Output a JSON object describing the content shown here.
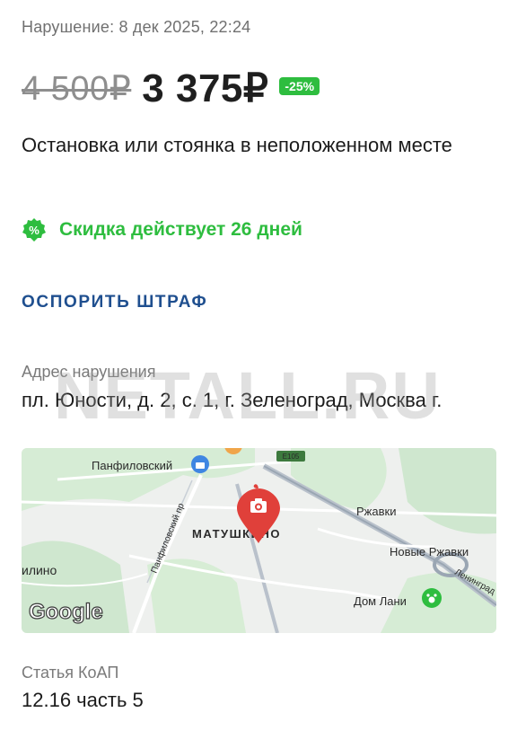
{
  "violation": {
    "date_text": "Нарушение: 8 дек 2025, 22:24",
    "old_price": "4 500₽",
    "new_price": "3 375₽",
    "discount_badge": "-25%",
    "title": "Остановка или стоянка в неположенном месте"
  },
  "discount": {
    "text": "Скидка действует 26 дней",
    "icon": "percent-badge-icon",
    "color": "#2ebd3f"
  },
  "actions": {
    "dispute_label": "ОСПОРИТЬ ШТРАФ",
    "color": "#1f4f8f"
  },
  "address": {
    "label": "Адрес нарушения",
    "value": "пл. Юности, д. 2, с. 1, г. Зеленоград, Москва г."
  },
  "watermark": "NETALL.RU",
  "map": {
    "labels": {
      "panfilovsky": "Панфиловский",
      "panfilovsky_pr": "Панфиловский пр",
      "matushkino": "МАТУШКИНО",
      "rzhavki": "Ржавки",
      "new_rzhavki": "Новые Ржавки",
      "leningrad": "Ленинград",
      "ilino": "илино",
      "dom_lani": "Дом Лани",
      "road_code": "E105",
      "google": "Google"
    },
    "pin_icon": "camera-pin-icon",
    "pin_color": "#e0403a"
  },
  "article": {
    "label": "Статья КоАП",
    "value": "12.16 часть 5"
  }
}
